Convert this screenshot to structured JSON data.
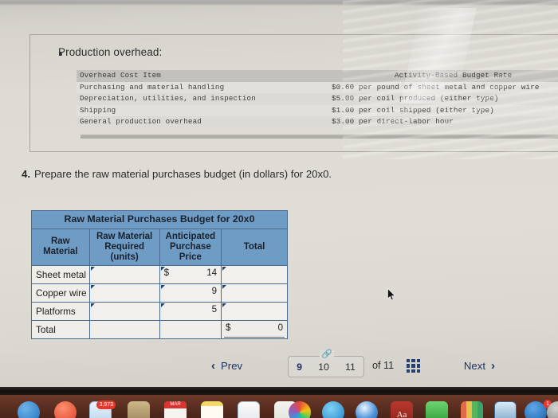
{
  "document": {
    "bullet_heading": "Production overhead:",
    "exhibit": {
      "col1_header": "Overhead Cost Item",
      "col2_header": "Activity-Based Budget Rate",
      "rows": [
        {
          "item": "Purchasing and material handling",
          "rate": "$0.60 per pound of sheet metal and copper wire"
        },
        {
          "item": "Depreciation, utilities, and inspection",
          "rate": "$5.00 per coil produced (either type)"
        },
        {
          "item": "Shipping",
          "rate": "$1.00 per coil shipped (either type)"
        },
        {
          "item": "General production overhead",
          "rate": "$3.00 per direct-labor hour"
        }
      ]
    },
    "question": {
      "number": "4.",
      "text": "Prepare the raw material purchases budget (in dollars) for 20x0."
    }
  },
  "budget_table": {
    "title": "Raw Material Purchases Budget for 20x0",
    "headers": {
      "col1": "Raw\nMaterial",
      "col1_line1": "Raw",
      "col1_line2": "Material",
      "col2_line1": "Raw Material",
      "col2_line2": "Required",
      "col2_line3": "(units)",
      "col3_line1": "Anticipated",
      "col3_line2": "Purchase",
      "col3_line3": "Price",
      "col4": "Total"
    },
    "rows": [
      {
        "material": "Sheet metal",
        "required": "",
        "price_currency": "$",
        "price": "14",
        "total": ""
      },
      {
        "material": "Copper wire",
        "required": "",
        "price_currency": "",
        "price": "9",
        "total": ""
      },
      {
        "material": "Platforms",
        "required": "",
        "price_currency": "",
        "price": "5",
        "total": ""
      }
    ],
    "total_row": {
      "label": "Total",
      "currency": "$",
      "value": "0"
    },
    "header_color": "#6f9cc4",
    "border_color": "#4a6b90"
  },
  "pagination": {
    "prev_label": "Prev",
    "next_label": "Next",
    "pages": [
      "9",
      "10",
      "11"
    ],
    "current_page": "10",
    "of_label": "of 11",
    "link_icon": "link-icon",
    "grid_icon": "grid-view-icon",
    "prev_chevron": "‹",
    "next_chevron": "›"
  },
  "dock": {
    "mail_badge": "3,973",
    "calendar_month": "MAR",
    "dictionary_glyph": "Aa",
    "appstore_badge": "1"
  }
}
